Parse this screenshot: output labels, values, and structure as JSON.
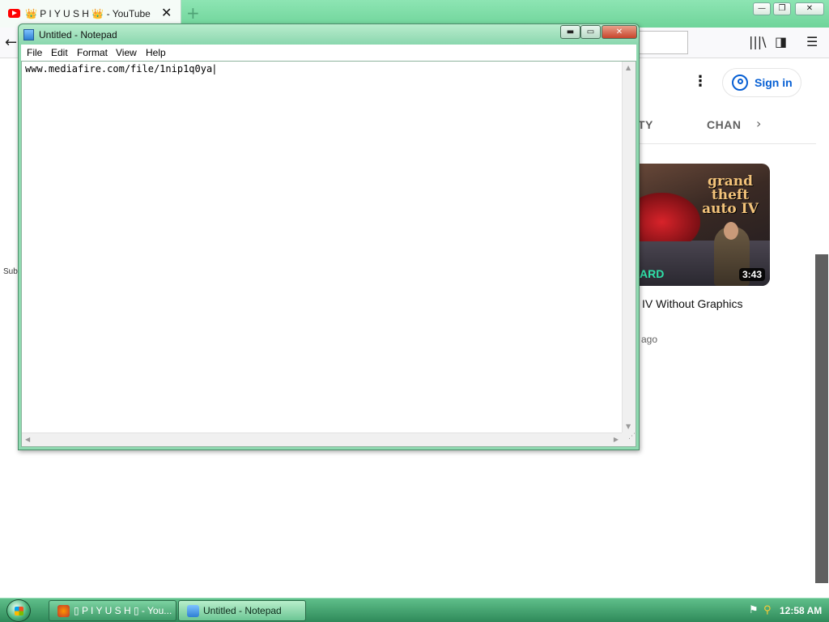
{
  "browser": {
    "tab_title": "👑 P I Y U S H 👑 - YouTube",
    "tab_close": "✕",
    "new_tab": "+",
    "window_buttons": {
      "minimize": "—",
      "restore": "❐",
      "close": "✕"
    },
    "back": "←",
    "toolbar_icons": {
      "library": "|||\\",
      "sidebar": "◨",
      "menu": "☰"
    }
  },
  "youtube": {
    "more": "⋮",
    "signin_label": "Sign in",
    "channel_tabs": [
      "TY",
      "CHAN"
    ],
    "tabs_next": "›",
    "sidebar_partial": "Sub",
    "video": {
      "thumbnail_logo": "grand theft auto IV",
      "thumbnail_partial_text": "ARD",
      "duration": "3:43",
      "title": "IV Without Graphics",
      "meta": "ago"
    }
  },
  "notepad": {
    "title": "Untitled - Notepad",
    "menu": [
      "File",
      "Edit",
      "Format",
      "View",
      "Help"
    ],
    "content": "www.mediafire.com/file/1nip1q0ya",
    "caption_buttons": {
      "minimize": "▬",
      "maximize": "▭",
      "close": "✕"
    }
  },
  "taskbar": {
    "items": [
      {
        "label": "▯ P I Y U S H ▯ - You...",
        "active": false
      },
      {
        "label": "Untitled - Notepad",
        "active": true
      }
    ],
    "clock": "12:58 AM"
  },
  "colors": {
    "taskbar": "#3d9a68",
    "youtube_red": "#ff0000",
    "youtube_blue": "#065fd4",
    "notepad_frame": "#8fd9b0"
  }
}
